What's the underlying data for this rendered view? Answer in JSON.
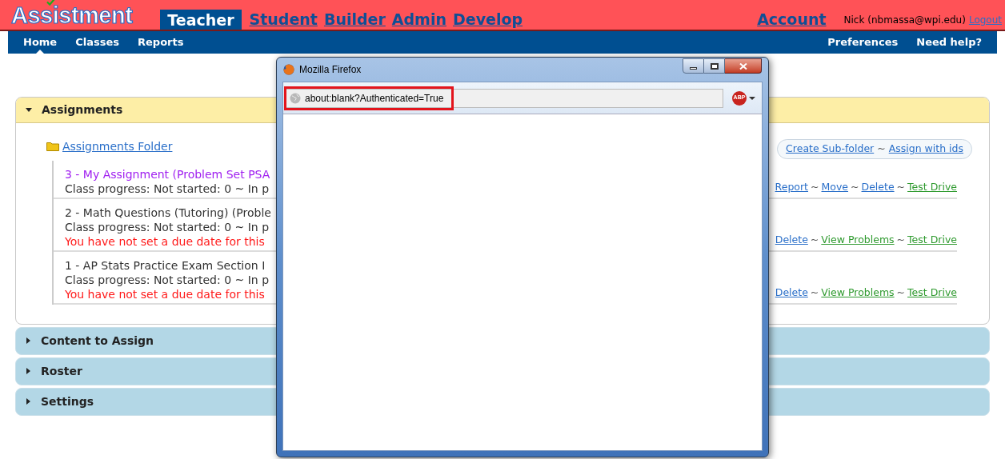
{
  "header": {
    "logo": "Assistment",
    "tabs": [
      {
        "label": "Teacher",
        "selected": true
      },
      {
        "label": "Student",
        "selected": false
      },
      {
        "label": "Builder",
        "selected": false
      },
      {
        "label": "Admin",
        "selected": false
      },
      {
        "label": "Develop",
        "selected": false
      }
    ],
    "account": "Account",
    "user": "Nick (nbmassa@wpi.edu)",
    "logout": "Logout"
  },
  "nav": {
    "left": [
      {
        "label": "Home",
        "selected": true
      },
      {
        "label": "Classes",
        "selected": false
      },
      {
        "label": "Reports",
        "selected": false
      }
    ],
    "right": [
      {
        "label": "Preferences",
        "selected": false
      },
      {
        "label": "Need help?",
        "selected": false
      }
    ]
  },
  "panels": [
    {
      "title": "Assignments",
      "expanded": true
    },
    {
      "title": "Content to Assign",
      "expanded": false
    },
    {
      "title": "Roster",
      "expanded": false
    },
    {
      "title": "Settings",
      "expanded": false
    }
  ],
  "assignments": {
    "folder": "Assignments Folder",
    "folder_actions": [
      {
        "label": "Create Sub-folder",
        "kind": "link"
      },
      {
        "label": "~",
        "kind": "separator"
      },
      {
        "label": "Assign with ids",
        "kind": "link"
      }
    ],
    "rows": [
      {
        "title": "3 - My Assignment (Problem Set PSA",
        "color": "#a020f0",
        "progress": "Class progress: Not started: 0 ~ In p",
        "actions": [
          {
            "label": "Report",
            "kind": "link"
          },
          {
            "label": "~",
            "kind": "separator"
          },
          {
            "label": "Move",
            "kind": "link"
          },
          {
            "label": "~",
            "kind": "separator"
          },
          {
            "label": "Delete",
            "kind": "link"
          },
          {
            "label": "~",
            "kind": "separator"
          },
          {
            "label": "Test Drive",
            "kind": "green"
          }
        ]
      },
      {
        "title": "2 - Math Questions (Tutoring) (Proble",
        "color": "#333333",
        "progress": "Class progress: Not started: 0 ~ In p",
        "warning": "You have not set a due date for this",
        "actions": [
          {
            "label": "Delete",
            "kind": "link"
          },
          {
            "label": "~",
            "kind": "separator"
          },
          {
            "label": "View Problems",
            "kind": "green"
          },
          {
            "label": "~",
            "kind": "separator"
          },
          {
            "label": "Test Drive",
            "kind": "green"
          }
        ]
      },
      {
        "title": "1 - AP Stats Practice Exam Section I",
        "color": "#333333",
        "progress": "Class progress: Not started: 0 ~ In p",
        "warning": "You have not set a due date for this",
        "actions": [
          {
            "label": "Delete",
            "kind": "link"
          },
          {
            "label": "~",
            "kind": "separator"
          },
          {
            "label": "View Problems",
            "kind": "green"
          },
          {
            "label": "~",
            "kind": "separator"
          },
          {
            "label": "Test Drive",
            "kind": "green"
          }
        ]
      }
    ]
  },
  "popup": {
    "title": "Mozilla Firefox",
    "url": "about:blank?Authenticated=True",
    "url_highlighted": true,
    "adblock": "ABP"
  }
}
